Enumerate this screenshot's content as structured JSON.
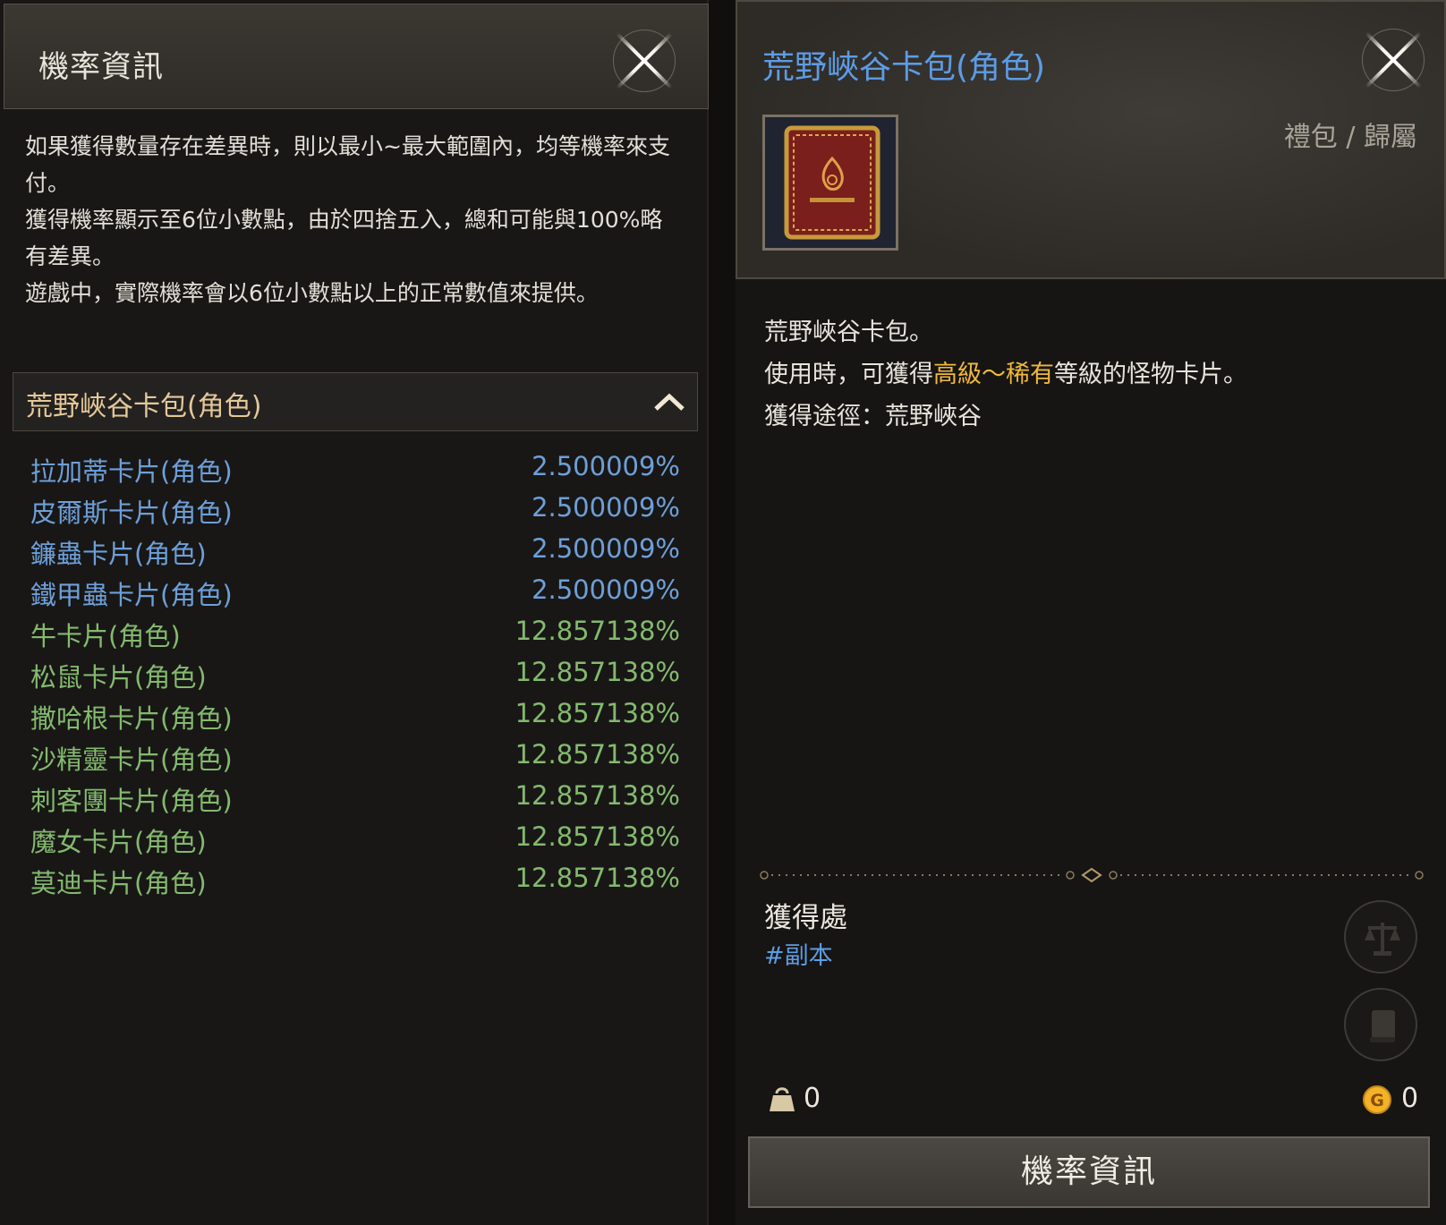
{
  "left_window": {
    "title": "機率資訊",
    "notice": [
      "如果獲得數量存在差異時，則以最小~最大範圍內，均等機率來支付。",
      "獲得機率顯示至6位小數點，由於四捨五入，總和可能與100%略有差異。",
      "遊戲中，實際機率會以6位小數點以上的正常數值來提供。"
    ],
    "pack_section": {
      "label": "荒野峽谷卡包(角色)",
      "expanded": true
    },
    "rates": [
      {
        "name": "拉加蒂卡片(角色)",
        "percent": "2.500009%",
        "grade": "blue"
      },
      {
        "name": "皮爾斯卡片(角色)",
        "percent": "2.500009%",
        "grade": "blue"
      },
      {
        "name": "鐮蟲卡片(角色)",
        "percent": "2.500009%",
        "grade": "blue"
      },
      {
        "name": "鐵甲蟲卡片(角色)",
        "percent": "2.500009%",
        "grade": "blue"
      },
      {
        "name": "牛卡片(角色)",
        "percent": "12.857138%",
        "grade": "green"
      },
      {
        "name": "松鼠卡片(角色)",
        "percent": "12.857138%",
        "grade": "green"
      },
      {
        "name": "撒哈根卡片(角色)",
        "percent": "12.857138%",
        "grade": "green"
      },
      {
        "name": "沙精靈卡片(角色)",
        "percent": "12.857138%",
        "grade": "green"
      },
      {
        "name": "刺客團卡片(角色)",
        "percent": "12.857138%",
        "grade": "green"
      },
      {
        "name": "魔女卡片(角色)",
        "percent": "12.857138%",
        "grade": "green"
      },
      {
        "name": "莫迪卡片(角色)",
        "percent": "12.857138%",
        "grade": "green"
      }
    ]
  },
  "right_window": {
    "title": "荒野峽谷卡包(角色)",
    "category": "禮包 / 歸屬",
    "item_icon": "card-pack-icon",
    "description": {
      "line1": "荒野峽谷卡包。",
      "line2_prefix": "使用時，可獲得",
      "line2_highlight": "高級～稀有",
      "line2_suffix": "等級的怪物卡片。",
      "line3": "獲得途徑：荒野峽谷"
    },
    "obtain": {
      "title": "獲得處",
      "tag": "#副本"
    },
    "weight_count": "0",
    "gold_count": "0",
    "prob_button": "機率資訊"
  },
  "colors": {
    "blue_grade": "#6e9fd8",
    "green_grade": "#84ba6e",
    "highlight": "#f0b83c",
    "title_blue": "#5d9ce4"
  }
}
